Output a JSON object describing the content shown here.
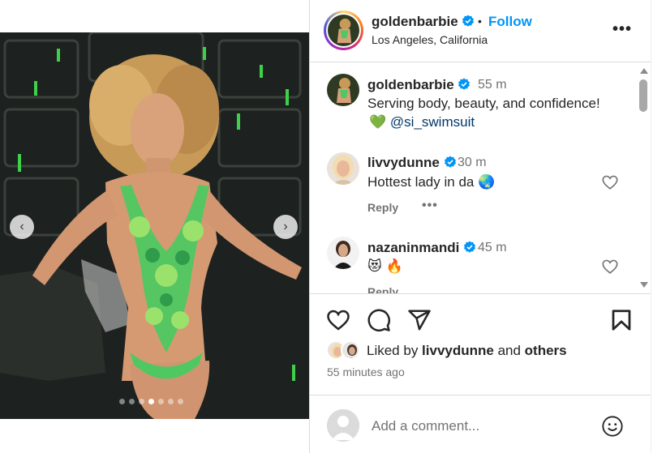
{
  "post": {
    "username": "goldenbarbie",
    "bullet": "•",
    "follow_label": "Follow",
    "location": "Los Angeles, California",
    "more_label": "•••"
  },
  "carousel": {
    "prev_label": "‹",
    "next_label": "›",
    "slide_count": 7,
    "active_slide": 4
  },
  "caption": {
    "username": "goldenbarbie",
    "time": "55 m",
    "text": "Serving body, beauty, and confidence!",
    "emoji": "💚",
    "mention": "@si_swimsuit"
  },
  "comments": [
    {
      "username": "livvydunne",
      "time": "30 m",
      "text": "Hottest lady in da 🌏",
      "reply_label": "Reply",
      "more_label": "•••"
    },
    {
      "username": "nazaninmandi",
      "time": "45 m",
      "text": "😻 🔥",
      "reply_label": "Reply"
    }
  ],
  "likes": {
    "prefix": "Liked by ",
    "user": "livvydunne",
    "middle": " and ",
    "others": "others"
  },
  "time_ago": "55 minutes ago",
  "add_comment": {
    "placeholder": "Add a comment..."
  },
  "icons": {
    "like": "heart-icon",
    "comment": "comment-icon",
    "share": "share-icon",
    "save": "bookmark-icon",
    "emoji": "smiley-icon",
    "verified": "verified-badge-icon"
  },
  "colors": {
    "accent": "#0095f6",
    "verified": "#0095f6",
    "text": "#262626",
    "secondary": "#737373",
    "mention": "#00376b",
    "swimsuit_green": "#4fc862"
  }
}
